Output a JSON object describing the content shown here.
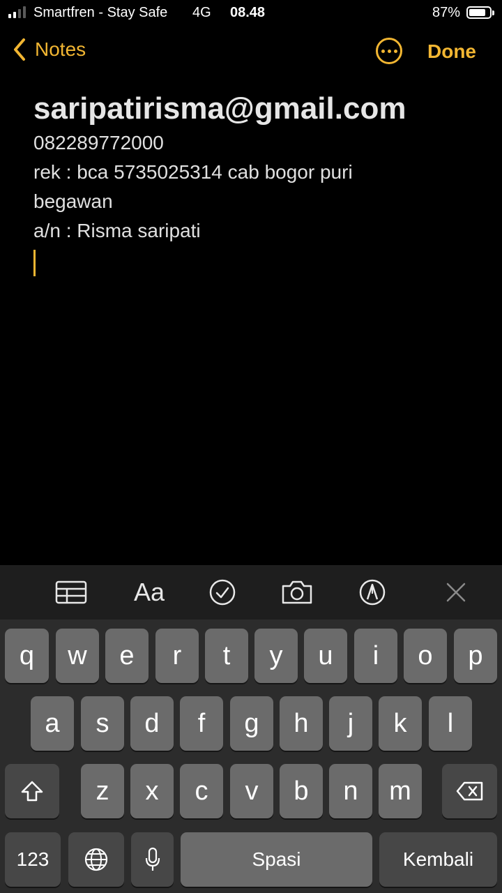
{
  "status_bar": {
    "carrier": "Smartfren - Stay Safe",
    "network": "4G",
    "time": "08.48",
    "battery_percent": "87%",
    "battery_level": 0.87
  },
  "nav": {
    "back_label": "Notes",
    "done_label": "Done",
    "accent_color": "#f2b632"
  },
  "note": {
    "title": "saripatirisma@gmail.com",
    "lines": [
      "082289772000",
      "rek : bca 5735025314 cab bogor puri",
      "begawan",
      "a/n : Risma saripati"
    ]
  },
  "toolbar": {
    "items": [
      "table-icon",
      "Aa",
      "checklist-icon",
      "camera-icon",
      "markup-icon",
      "close-icon"
    ]
  },
  "keyboard": {
    "row1": [
      "q",
      "w",
      "e",
      "r",
      "t",
      "y",
      "u",
      "i",
      "o",
      "p"
    ],
    "row2": [
      "a",
      "s",
      "d",
      "f",
      "g",
      "h",
      "j",
      "k",
      "l"
    ],
    "row3": [
      "z",
      "x",
      "c",
      "v",
      "b",
      "n",
      "m"
    ],
    "numbers_label": "123",
    "space_label": "Spasi",
    "return_label": "Kembali"
  }
}
